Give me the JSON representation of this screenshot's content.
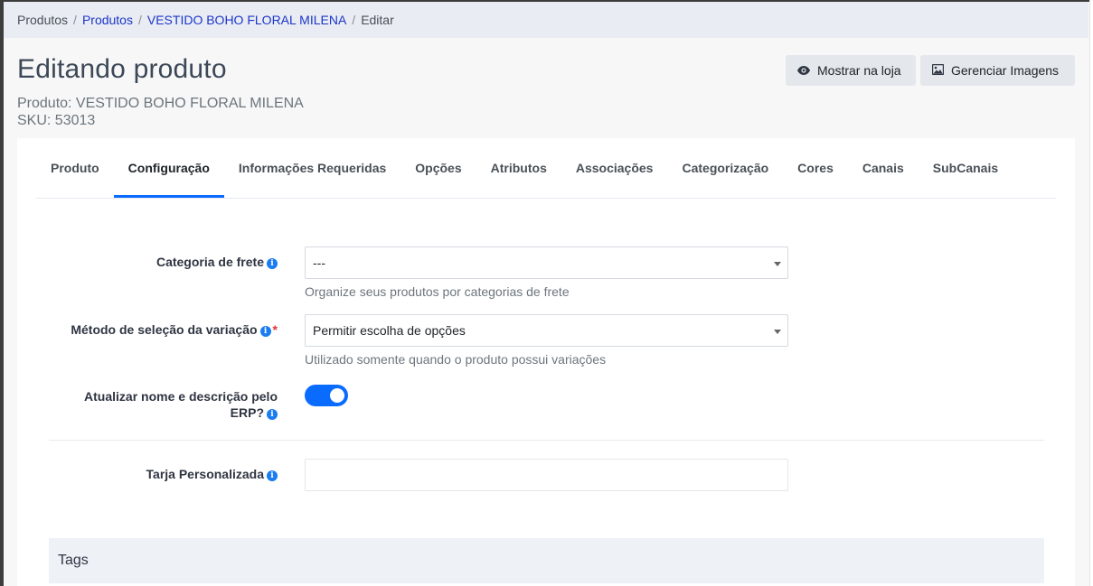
{
  "breadcrumb": {
    "items": [
      "Produtos",
      "Produtos",
      "VESTIDO BOHO FLORAL MILENA",
      "Editar"
    ],
    "separator": "/"
  },
  "page": {
    "title": "Editando produto",
    "product_line": "Produto: VESTIDO BOHO FLORAL MILENA",
    "sku_line": "SKU: 53013"
  },
  "actions": {
    "show_in_store": "Mostrar na loja",
    "manage_images": "Gerenciar Imagens"
  },
  "tabs": [
    {
      "label": "Produto",
      "active": false
    },
    {
      "label": "Configuração",
      "active": true
    },
    {
      "label": "Informações Requeridas",
      "active": false
    },
    {
      "label": "Opções",
      "active": false
    },
    {
      "label": "Atributos",
      "active": false
    },
    {
      "label": "Associações",
      "active": false
    },
    {
      "label": "Categorização",
      "active": false
    },
    {
      "label": "Cores",
      "active": false
    },
    {
      "label": "Canais",
      "active": false
    },
    {
      "label": "SubCanais",
      "active": false
    }
  ],
  "form": {
    "freight_category": {
      "label": "Categoria de frete",
      "value": "---",
      "help": "Organize seus produtos por categorias de frete"
    },
    "variation_method": {
      "label": "Método de seleção da variação",
      "required_mark": "*",
      "value": "Permitir escolha de opções",
      "help": "Utilizado somente quando o produto possui variações"
    },
    "erp_update": {
      "label_line1": "Atualizar nome e descrição pelo",
      "label_line2": "ERP?",
      "enabled": true
    },
    "custom_stripe": {
      "label": "Tarja Personalizada",
      "value": ""
    }
  },
  "tags": {
    "title": "Tags"
  },
  "colors": {
    "accent": "#0a6cff",
    "link": "#1b36c9",
    "info_icon": "#1b7cf2",
    "required": "#e3342f"
  },
  "icons": [
    "eye-icon",
    "image-icon",
    "info-icon",
    "chevron-down-icon"
  ]
}
